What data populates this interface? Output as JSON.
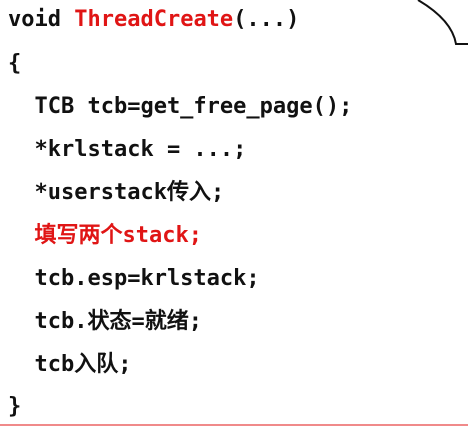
{
  "code": {
    "l1_keyword": "void ",
    "l1_func": "ThreadCreate",
    "l1_rest": "(...)",
    "l2": "{",
    "l3": "  TCB tcb=get_free_page();",
    "l4": "  *krlstack = ...;",
    "l5": "  *userstack传入;",
    "l6": "  填写两个stack;",
    "l7": "  tcb.esp=krlstack;",
    "l8": "  tcb.状态=就绪;",
    "l9": "  tcb入队;",
    "l10": "}"
  },
  "colors": {
    "highlight": "#e01515",
    "text": "#111111",
    "rule": "#f08a8a"
  }
}
